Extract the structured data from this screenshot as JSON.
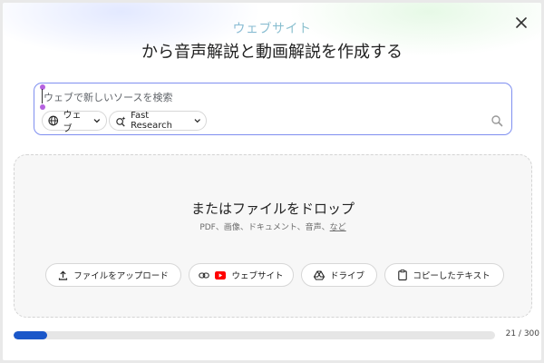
{
  "header": {
    "kicker": "ウェブサイト",
    "title": "から音声解説と動画解説を作成する",
    "close_icon": "close-icon"
  },
  "search": {
    "placeholder": "ウェブで新しいソースを検索",
    "source_chip_label": "ウェブ",
    "mode_chip_label": "Fast Research",
    "icons": [
      "globe-icon",
      "sparkle-search-icon",
      "chevron-down-icon",
      "search-icon"
    ]
  },
  "dropzone": {
    "title": "またはファイルをドロップ",
    "subtitle": "PDF、画像、ドキュメント、音声、",
    "subtitle_more": "など",
    "buttons": [
      {
        "label": "ファイルをアップロード",
        "icon": "upload-icon"
      },
      {
        "label": "ウェブサイト",
        "icon": "link-youtube-icon"
      },
      {
        "label": "ドライブ",
        "icon": "drive-icon"
      },
      {
        "label": "コピーしたテキスト",
        "icon": "clipboard-icon"
      }
    ]
  },
  "progress": {
    "current": 21,
    "max": 300,
    "label": "21 / 300",
    "color": "#1a57c9"
  },
  "colors": {
    "search_border": "#7f8ff0",
    "cursor_dot": "#b562e0",
    "youtube_red": "#ff0000"
  }
}
